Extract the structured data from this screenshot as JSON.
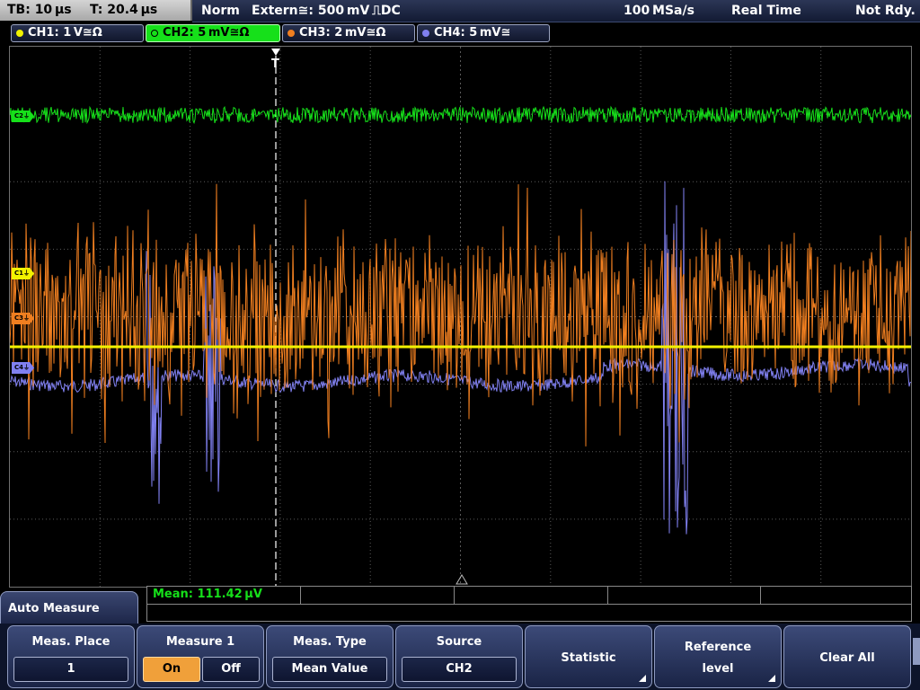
{
  "status": {
    "timebase": "TB: 10 µs",
    "trigger_time": "T: 20.4 µs",
    "mode": "Norm",
    "trigger_source": "Extern≅: 500 mV ⎍DC",
    "sample_rate": "100 MSa/s",
    "acq_mode": "Real Time",
    "state": "Not Rdy."
  },
  "channels": [
    {
      "label": "CH1: 1 V≅Ω",
      "color": "#f2f200",
      "active": false
    },
    {
      "label": "CH2: 5 mV≅Ω",
      "color": "#16e01a",
      "active": true
    },
    {
      "label": "CH3: 2 mV≅Ω",
      "color": "#f07f20",
      "active": false
    },
    {
      "label": "CH4: 5 mV≅",
      "color": "#8080f0",
      "active": false
    }
  ],
  "markers": {
    "c1": "C1⏚",
    "c2": "C2⏚",
    "c3": "C3⏚",
    "c4": "C4⏚",
    "trigger": "T"
  },
  "measurement": {
    "mean": "Mean: 111.42 µV"
  },
  "panel": {
    "title": "Auto Measure",
    "softkeys": {
      "meas_place": {
        "label": "Meas. Place",
        "value": "1"
      },
      "measure1": {
        "label": "Measure 1",
        "on": "On",
        "off": "Off",
        "state": "On"
      },
      "meas_type": {
        "label": "Meas. Type",
        "value": "Mean Value"
      },
      "source": {
        "label": "Source",
        "value": "CH2"
      },
      "statistic": {
        "label": "Statistic"
      },
      "reference": {
        "label1": "Reference",
        "label2": "level"
      },
      "clear_all": {
        "label": "Clear All"
      }
    }
  },
  "colors": {
    "ch1": "#f2f200",
    "ch2": "#16e01a",
    "ch3": "#f07f20",
    "ch4": "#8080f0",
    "grid": "#5a5a5a"
  }
}
